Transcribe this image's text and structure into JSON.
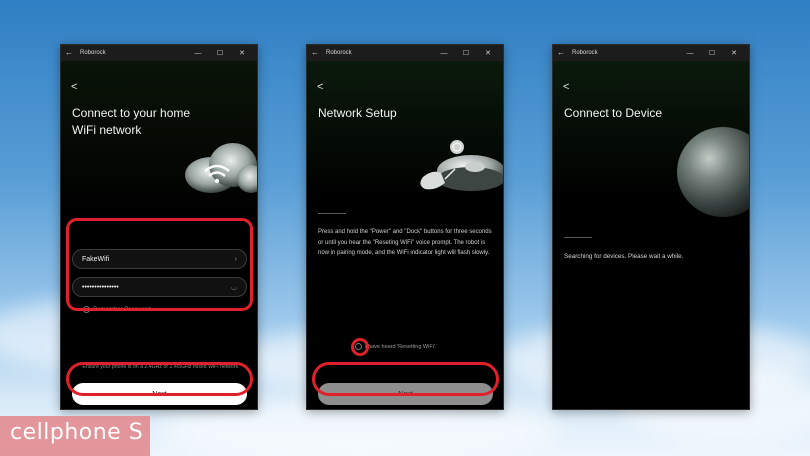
{
  "colors": {
    "highlight": "#e0202a",
    "accent_bg": "#5a9fd6",
    "brand": "#e28d92"
  },
  "windows": [
    {
      "app_title": "Roborock",
      "heading": "Connect to your home WiFi network",
      "wifi_field": {
        "value": "FakeWifi"
      },
      "password_field": {
        "value": "•••••••••••••••"
      },
      "remember_label": "Remember Password",
      "hint": "Ensure your phone is on a 2.4GHz or 2.4/5GHz mixed WiFi network.",
      "button_label": "Next"
    },
    {
      "app_title": "Roborock",
      "heading": "Network Setup",
      "instructions": "Press and hold the \"Power\" and \"Dock\" buttons for three seconds or until you hear the \"Reseting WiFi\" voice prompt. The robot is now in pairing mode, and the WiFi indicator light will flash slowly.",
      "confirm_label": "I have heard 'Resetting WiFi'.",
      "button_label": "Next"
    },
    {
      "app_title": "Roborock",
      "heading": "Connect to Device",
      "status": "Searching for devices. Please wait a while."
    }
  ],
  "brand": {
    "logo_text": "cellphone S"
  }
}
